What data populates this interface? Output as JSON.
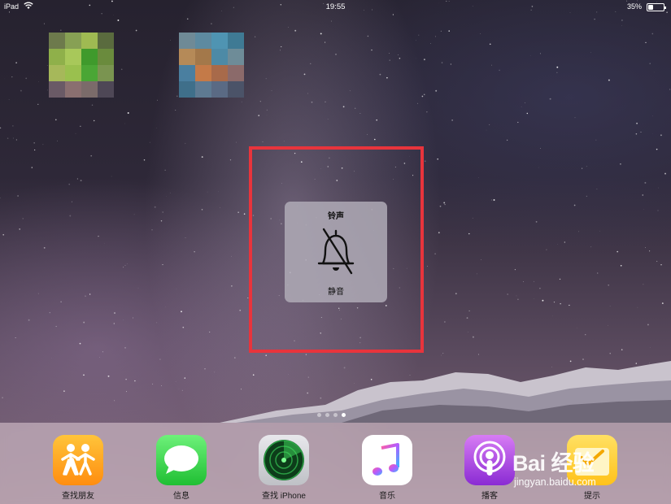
{
  "status_bar": {
    "device": "iPad",
    "time": "19:55",
    "battery_percent": "35%",
    "battery_level": 0.35
  },
  "hud": {
    "title": "铃声",
    "subtitle": "静音",
    "icon": "bell-slash-icon"
  },
  "page_dots": {
    "count": 4,
    "active_index": 3
  },
  "dock": {
    "apps": [
      {
        "label": "查找朋友",
        "icon": "find-friends-icon"
      },
      {
        "label": "信息",
        "icon": "messages-icon"
      },
      {
        "label": "查找 iPhone",
        "icon": "find-iphone-icon"
      },
      {
        "label": "音乐",
        "icon": "music-icon"
      },
      {
        "label": "播客",
        "icon": "podcasts-icon"
      },
      {
        "label": "提示",
        "icon": "reminders-icon"
      }
    ]
  },
  "watermark": {
    "logo": "Bai 经验",
    "url": "jingyan.baidu.com"
  },
  "colors": {
    "highlight": "#e8343c",
    "hud_background": "#afaab6"
  }
}
